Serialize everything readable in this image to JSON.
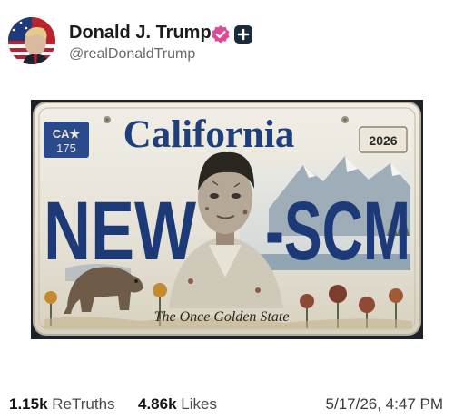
{
  "post": {
    "author": {
      "display_name": "Donald J. Trump",
      "handle": "@realDonaldTrump",
      "verified_icon": "verified-badge-icon",
      "badge_icon": "plus-badge-icon",
      "badge_color": "#e0489a"
    },
    "image": {
      "plate_state": "California",
      "plate_sticker_line1": "CA★",
      "plate_sticker_line2": "175",
      "plate_year": "2026",
      "plate_left": "NEW",
      "plate_right": "-SCM",
      "plate_slogan": "The Once Golden State"
    },
    "stats": {
      "retruths_count": "1.15k",
      "retruths_label": "ReTruths",
      "likes_count": "4.86k",
      "likes_label": "Likes"
    },
    "timestamp": "5/17/26, 4:47 PM"
  }
}
